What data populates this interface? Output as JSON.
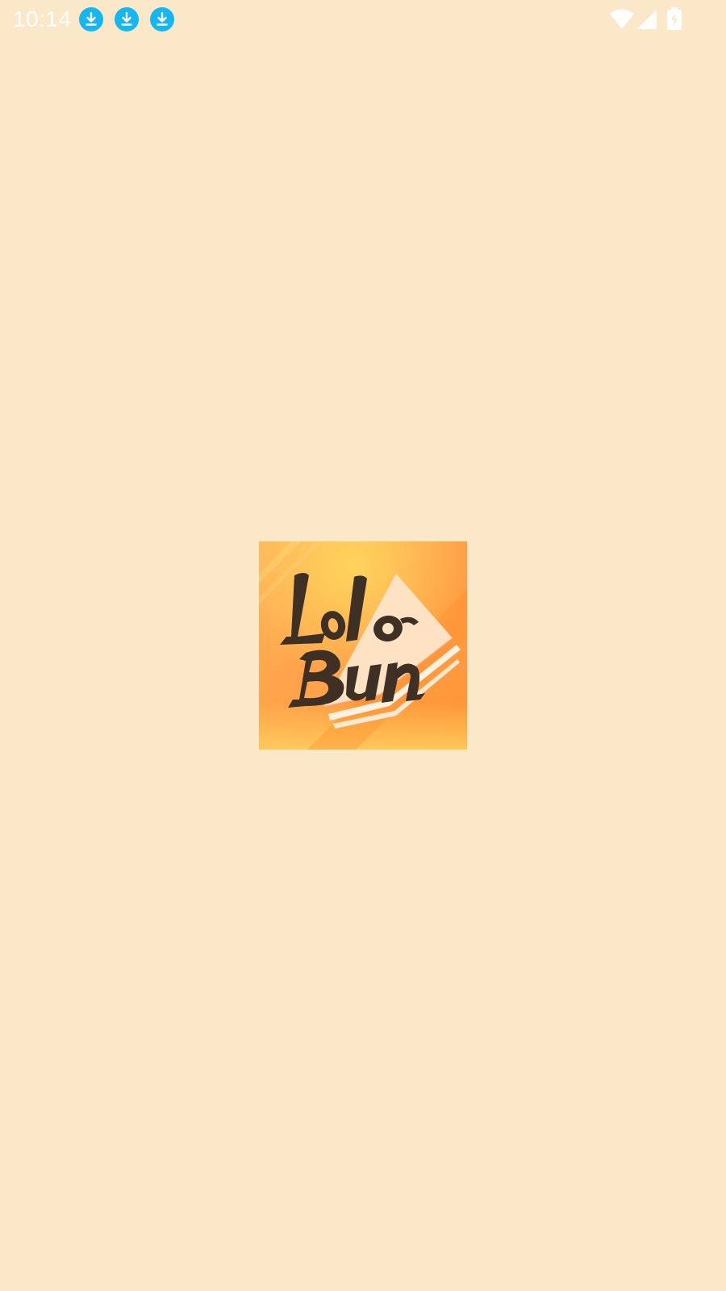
{
  "status_bar": {
    "time": "10:14",
    "notification_icons": [
      "download-icon",
      "download-icon",
      "download-icon"
    ],
    "system_icons": [
      "wifi-icon",
      "signal-icon",
      "battery-charging-icon"
    ],
    "accent_color": "#16B6F0"
  },
  "splash": {
    "background_color": "#FBE8C9",
    "logo": {
      "line1": "Lolo",
      "line2": "Bun",
      "text_color": "#3F3026",
      "colors": [
        "#FFC65A",
        "#FF9A3C",
        "#FFE2C4"
      ]
    }
  }
}
